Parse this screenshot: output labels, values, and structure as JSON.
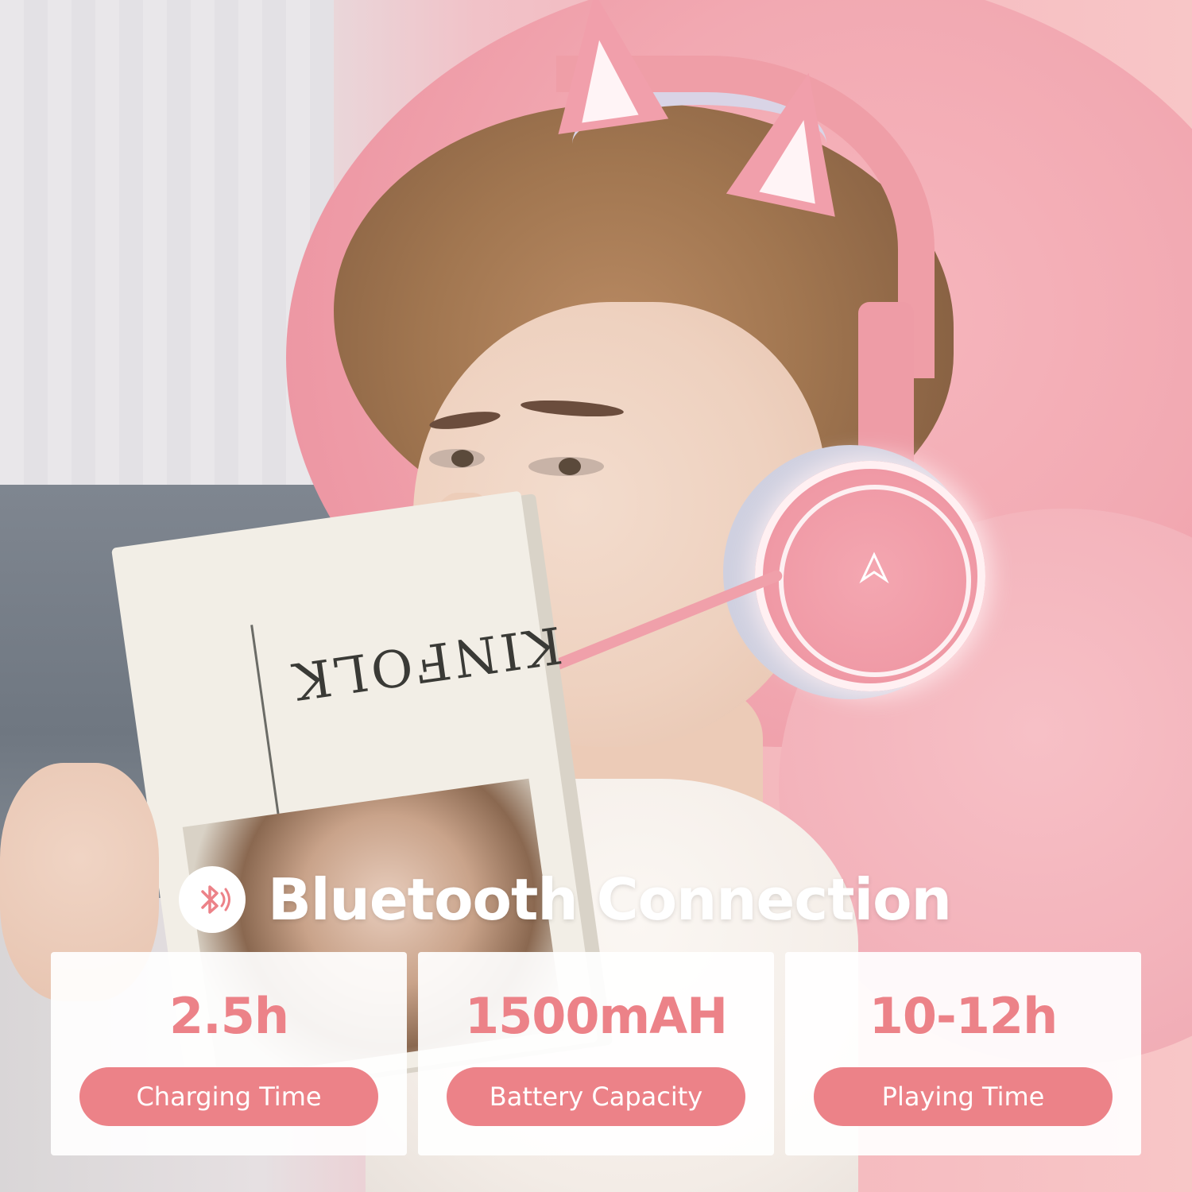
{
  "headline": {
    "icon": "bluetooth-sound-icon",
    "text": "Bluetooth Connection"
  },
  "stats": [
    {
      "value": "2.5h",
      "label": "Charging Time"
    },
    {
      "value": "1500mAH",
      "label": "Battery Capacity"
    },
    {
      "value": "10-12h",
      "label": "Playing Time"
    }
  ],
  "book": {
    "title": "KINFOLK"
  },
  "colors": {
    "accent": "#ec8288",
    "pillow": "#f2a9b2",
    "card_bg": "#ffffff"
  }
}
